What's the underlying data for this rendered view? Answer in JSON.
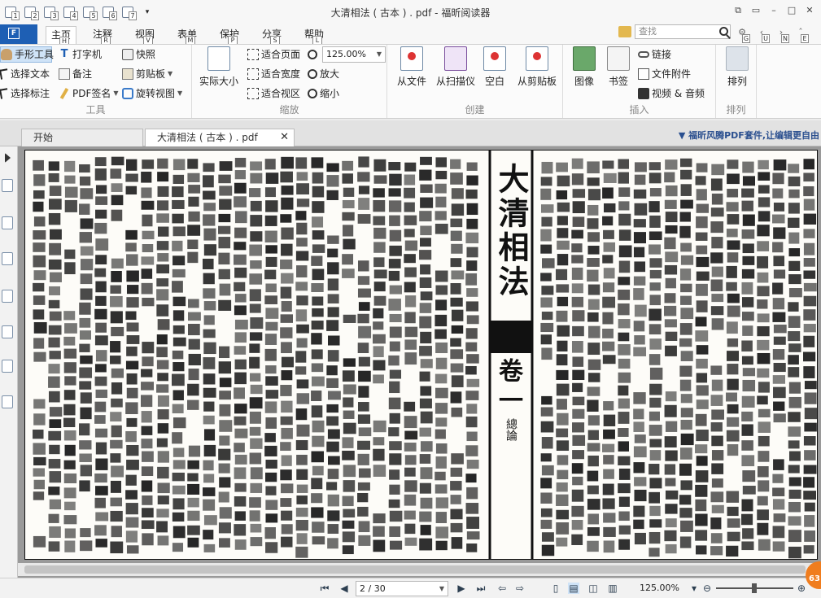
{
  "window": {
    "title": "大清相法 ( 古本 ) . pdf - 福昕阅读器",
    "quick_access_keys": [
      "1",
      "2",
      "3",
      "4",
      "5",
      "6",
      "7"
    ],
    "controls": [
      "restore-down",
      "ribbon-toggle",
      "minimize",
      "maximize",
      "close"
    ]
  },
  "menu": {
    "file_label": "F",
    "file_key": "F",
    "tabs": [
      {
        "label": "主页",
        "key": "H",
        "active": true
      },
      {
        "label": "注释",
        "key": "R"
      },
      {
        "label": "视图",
        "key": "V"
      },
      {
        "label": "表单",
        "key": "M"
      },
      {
        "label": "保护",
        "key": "P"
      },
      {
        "label": "分享",
        "key": "S"
      },
      {
        "label": "帮助",
        "key": "L"
      }
    ],
    "search_placeholder": "查找",
    "search_key": "D",
    "right_keys": [
      "G",
      "U",
      "N",
      "E"
    ]
  },
  "ribbon": {
    "tools": {
      "label": "工具",
      "hand": "手形工具",
      "typewriter": "打字机",
      "snapshot": "快照",
      "select_text": "选择文本",
      "note": "备注",
      "clipboard": "剪贴板",
      "select_annotation": "选择标注",
      "pdf_sign": "PDF签名",
      "rotate_view": "旋转视图"
    },
    "zoom": {
      "label": "缩放",
      "actual_size": "实际大小",
      "fit_page": "适合页面",
      "fit_width": "适合宽度",
      "fit_visible": "适合视区",
      "zoom_value": "125.00%",
      "zoom_in": "放大",
      "zoom_out": "缩小"
    },
    "create": {
      "label": "创建",
      "from_file": "从文件",
      "from_scanner": "从扫描仪",
      "blank": "空白",
      "from_clipboard": "从剪贴板"
    },
    "insert": {
      "label": "插入",
      "image": "图像",
      "bookmark": "书签",
      "link": "链接",
      "file_attachment": "文件附件",
      "video_audio": "视频 & 音频"
    },
    "arrange": {
      "label": "排列",
      "arrange": "排列"
    }
  },
  "document_tabs": {
    "items": [
      {
        "label": "开始"
      },
      {
        "label": "大清相法 ( 古本 ) . pdf",
        "active": true
      }
    ],
    "promo": "福昕风腾PDF套件,让编辑更自由"
  },
  "page_text": {
    "title_big": "大清相法",
    "volume": "卷一",
    "section": "總論"
  },
  "status": {
    "page_display": "2 / 30",
    "zoom": "125.00%",
    "badge": "63"
  },
  "colors": {
    "file_tab": "#1e5fb4",
    "badge": "#f07d1e",
    "page": "#fdfcf8"
  }
}
